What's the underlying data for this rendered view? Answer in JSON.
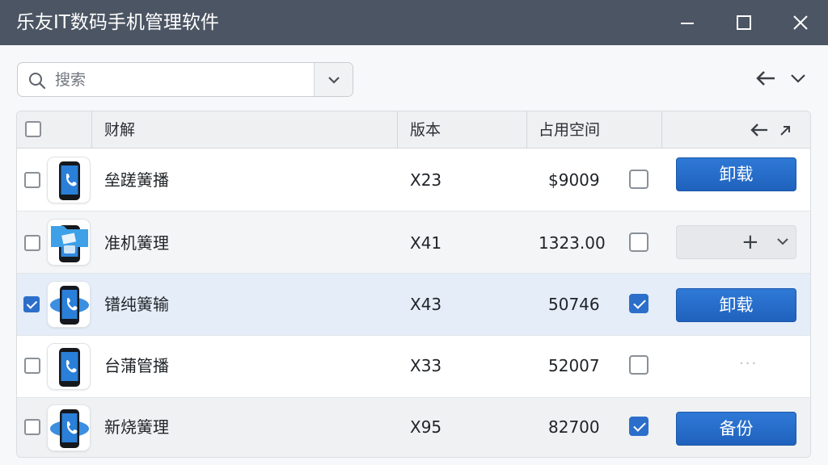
{
  "window": {
    "title": "乐友IT数码手机管理软件"
  },
  "search": {
    "placeholder": "搜索"
  },
  "table": {
    "columns": {
      "name": "财解",
      "version": "版本",
      "space": "占用空间"
    },
    "rows": [
      {
        "name": "垒蹉簧播",
        "version": "X23",
        "space": "$9009",
        "checked": false,
        "action_checked": false,
        "action": "卸载",
        "icon": "phone-icon"
      },
      {
        "name": "准机簧理",
        "version": "X41",
        "space": "1323.00",
        "checked": false,
        "action_checked": false,
        "action": "+",
        "icon": "phone-folder-icon"
      },
      {
        "name": "镨纯簧输",
        "version": "X43",
        "space": "50746",
        "checked": true,
        "action_checked": true,
        "action": "卸载",
        "icon": "phone-sync-icon"
      },
      {
        "name": "台蒲管播",
        "version": "X33",
        "space": "52007",
        "checked": false,
        "action_checked": false,
        "action": "···",
        "icon": "phone-icon"
      },
      {
        "name": "新烧簧理",
        "version": "X95",
        "space": "82700",
        "checked": false,
        "action_checked": true,
        "action": "备份",
        "icon": "phone-sync-icon"
      }
    ]
  },
  "colors": {
    "titlebar": "#4c5563",
    "accent": "#2c6fca",
    "selected_row": "#e4edf8",
    "alt_row": "#f0f1f3"
  }
}
